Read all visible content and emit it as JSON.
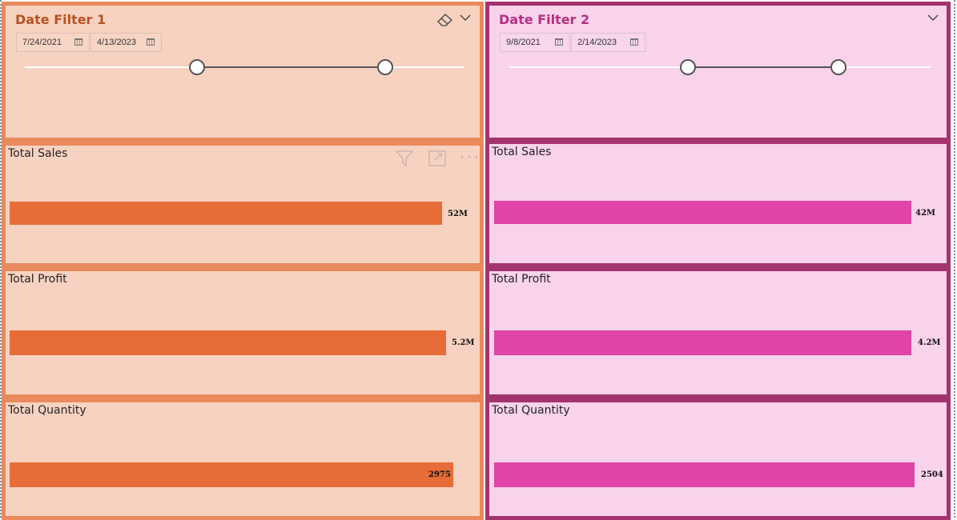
{
  "colors": {
    "filter1_border": "#e98a5e",
    "filter1_background": "#f7d2c1",
    "filter1_title": "#b55321",
    "filter1_bar": "#e76c37",
    "filter2_border": "#a3336f",
    "filter2_background": "#f8d3ea",
    "filter2_title": "#b62f84",
    "filter2_bar": "#e044a7"
  },
  "filter1": {
    "title": "Date Filter 1",
    "start_date": "7/24/2021",
    "end_date": "4/13/2023",
    "icons": [
      "eraser-icon",
      "chevron-down-icon",
      "calendar-icon"
    ],
    "range_start_fraction": 0.39,
    "range_end_fraction": 0.82
  },
  "filter2": {
    "title": "Date Filter 2",
    "start_date": "9/8/2021",
    "end_date": "2/14/2023",
    "icons": [
      "chevron-down-icon",
      "calendar-icon"
    ],
    "range_start_fraction": 0.42,
    "range_end_fraction": 0.78
  },
  "visual_header_icons": [
    "filter-icon",
    "focus-mode-icon",
    "more-options-icon"
  ],
  "left_cards": [
    {
      "title": "Total Sales",
      "value_label": "52M"
    },
    {
      "title": "Total Profit",
      "value_label": "5.2M"
    },
    {
      "title": "Total Quantity",
      "value_label": "2975"
    }
  ],
  "right_cards": [
    {
      "title": "Total Sales",
      "value_label": "42M"
    },
    {
      "title": "Total Profit",
      "value_label": "4.2M"
    },
    {
      "title": "Total Quantity",
      "value_label": "2504"
    }
  ]
}
